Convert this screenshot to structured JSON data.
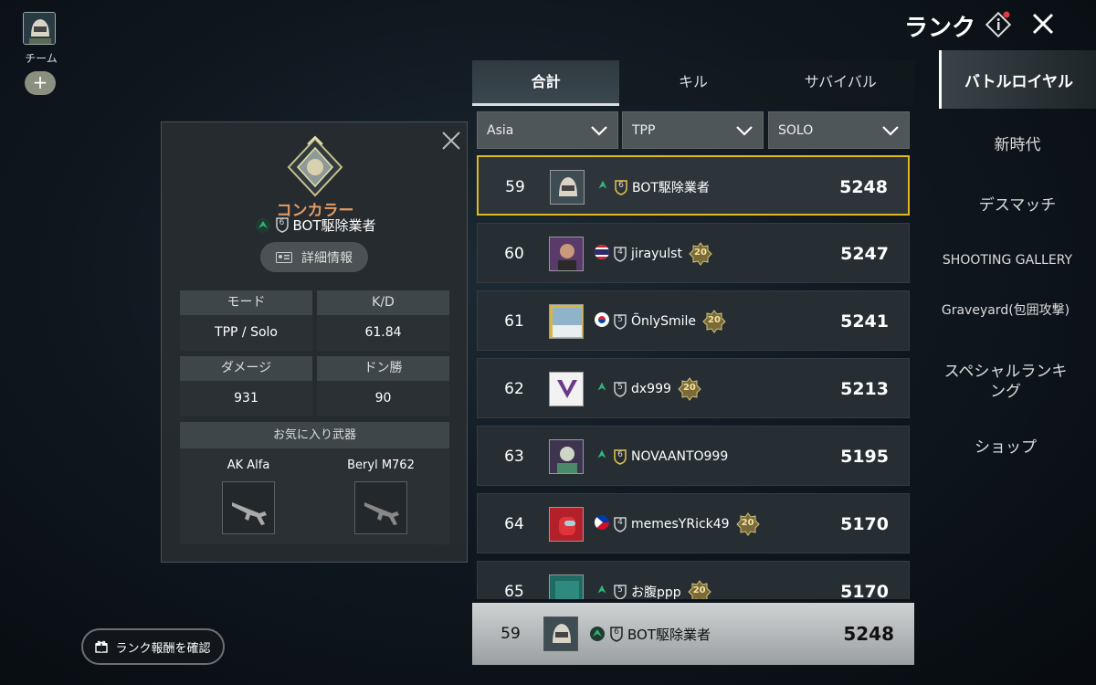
{
  "team": {
    "label": "チーム",
    "add_label": "+"
  },
  "header": {
    "title": "ランク"
  },
  "profile": {
    "rank_name": "コンカラー",
    "player_name": "BOT駆除業者",
    "tier_level": "6",
    "details_label": "詳細情報",
    "stats": [
      {
        "label": "モード",
        "value": "TPP / Solo"
      },
      {
        "label": "K/D",
        "value": "61.84"
      },
      {
        "label": "ダメージ",
        "value": "931"
      },
      {
        "label": "ドン勝",
        "value": "90"
      }
    ],
    "favorite_weapons_label": "お気に入り武器",
    "weapons": [
      "AK Alfa",
      "Beryl M762"
    ]
  },
  "reward_button": {
    "label": "ランク報酬を確認"
  },
  "tabs": [
    {
      "label": "合計",
      "active": true
    },
    {
      "label": "キル",
      "active": false
    },
    {
      "label": "サバイバル",
      "active": false
    }
  ],
  "filters": [
    {
      "value": "Asia"
    },
    {
      "value": "TPP"
    },
    {
      "value": "SOLO"
    }
  ],
  "leaderboard": [
    {
      "rank": "59",
      "name": "BOT駆除業者",
      "tier": "6",
      "score": "5248",
      "flag": "",
      "badge": "",
      "highlight": true,
      "avatar": "helmet"
    },
    {
      "rank": "60",
      "name": "jirayulst",
      "tier": "4",
      "score": "5247",
      "flag": "thailand",
      "badge": "20",
      "highlight": false,
      "avatar": "portrait"
    },
    {
      "rank": "61",
      "name": "ÕnlySmile",
      "tier": "5",
      "score": "5241",
      "flag": "korea",
      "badge": "20",
      "highlight": false,
      "avatar": "landscape"
    },
    {
      "rank": "62",
      "name": "dx999",
      "tier": "5",
      "score": "5213",
      "flag": "",
      "badge": "20",
      "highlight": false,
      "avatar": "logo"
    },
    {
      "rank": "63",
      "name": "NOVAANTO999",
      "tier": "6",
      "score": "5195",
      "flag": "",
      "badge": "",
      "highlight": false,
      "avatar": "character"
    },
    {
      "rank": "64",
      "name": "memesYRick49",
      "tier": "4",
      "score": "5170",
      "flag": "philippines",
      "badge": "20",
      "highlight": false,
      "avatar": "red"
    },
    {
      "rank": "65",
      "name": "お腹ppp",
      "tier": "5",
      "score": "5170",
      "flag": "",
      "badge": "20",
      "highlight": false,
      "avatar": "teal"
    }
  ],
  "self_row": {
    "rank": "59",
    "name": "BOT駆除業者",
    "tier": "6",
    "score": "5248"
  },
  "nav": [
    {
      "label": "バトルロイヤル",
      "active": true
    },
    {
      "label": "新時代",
      "active": false
    },
    {
      "label": "デスマッチ",
      "active": false
    },
    {
      "label": "SHOOTING GALLERY",
      "active": false
    },
    {
      "label": "Graveyard(包囲攻撃)",
      "active": false
    },
    {
      "label": "スペシャルランキング",
      "active": false
    },
    {
      "label": "ショップ",
      "active": false
    }
  ],
  "colors": {
    "highlight_border": "#e2b81e",
    "rank_name": "#e39a63",
    "emblem_green": "#2fb57a"
  },
  "icons": [
    "info-icon",
    "close-icon",
    "chevron-down-icon",
    "gift-icon",
    "id-card-icon",
    "conqueror-badge-icon",
    "emblem-icon",
    "tier-shield-icon",
    "rank-20-badge-icon",
    "rifle-icon"
  ]
}
